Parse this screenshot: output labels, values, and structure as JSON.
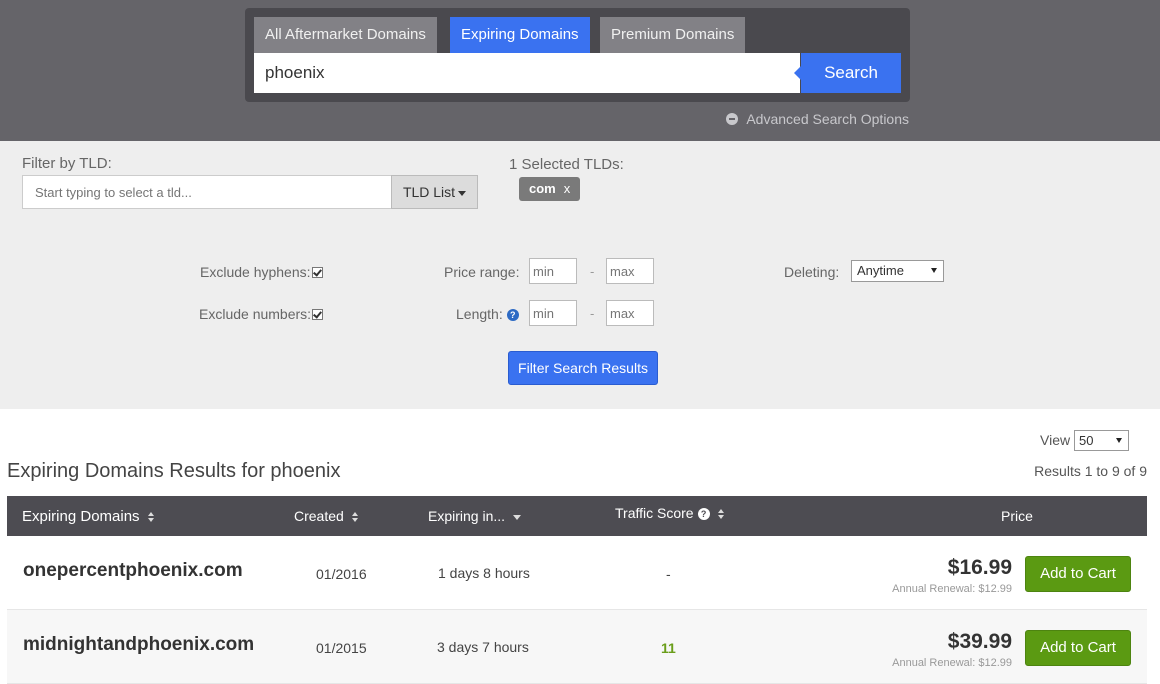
{
  "search": {
    "tabs": [
      {
        "label": "All Aftermarket Domains",
        "active": false
      },
      {
        "label": "Expiring Domains",
        "active": true
      },
      {
        "label": "Premium Domains",
        "active": false
      }
    ],
    "query": "phoenix",
    "button": "Search",
    "advanced": "Advanced Search Options"
  },
  "filters": {
    "tld_label": "Filter by TLD:",
    "tld_placeholder": "Start typing to select a tld...",
    "tld_list_button": "TLD List",
    "selected_label": "1 Selected TLDs:",
    "selected_tlds": [
      "com"
    ],
    "chip_remove": "x",
    "exclude_hyphens_label": "Exclude hyphens:",
    "exclude_hyphens": true,
    "exclude_numbers_label": "Exclude numbers:",
    "exclude_numbers": true,
    "price_range_label": "Price range:",
    "length_label": "Length:",
    "min_placeholder": "min",
    "max_placeholder": "max",
    "dash": "-",
    "deleting_label": "Deleting:",
    "deleting_value": "Anytime",
    "filter_button": "Filter Search Results"
  },
  "results": {
    "view_label": "View",
    "view_value": "50",
    "title": "Expiring Domains Results for phoenix",
    "count": "Results 1 to 9 of 9",
    "columns": {
      "domain": "Expiring Domains",
      "created": "Created",
      "expiring": "Expiring in...",
      "traffic": "Traffic Score",
      "price": "Price"
    },
    "rows": [
      {
        "domain": "onepercentphoenix.com",
        "created": "01/2016",
        "expiring": "1 days 8 hours",
        "traffic": "-",
        "price": "$16.99",
        "renewal": "Annual Renewal: $12.99",
        "button": "Add to Cart"
      },
      {
        "domain": "midnightandphoenix.com",
        "created": "01/2015",
        "expiring": "3 days 7 hours",
        "traffic": "11",
        "price": "$39.99",
        "renewal": "Annual Renewal: $12.99",
        "button": "Add to Cart"
      }
    ]
  },
  "colors": {
    "accent": "#3a72f0",
    "cart_green": "#5b9a12",
    "header_band": "#656469",
    "table_header": "#4d4c52"
  }
}
